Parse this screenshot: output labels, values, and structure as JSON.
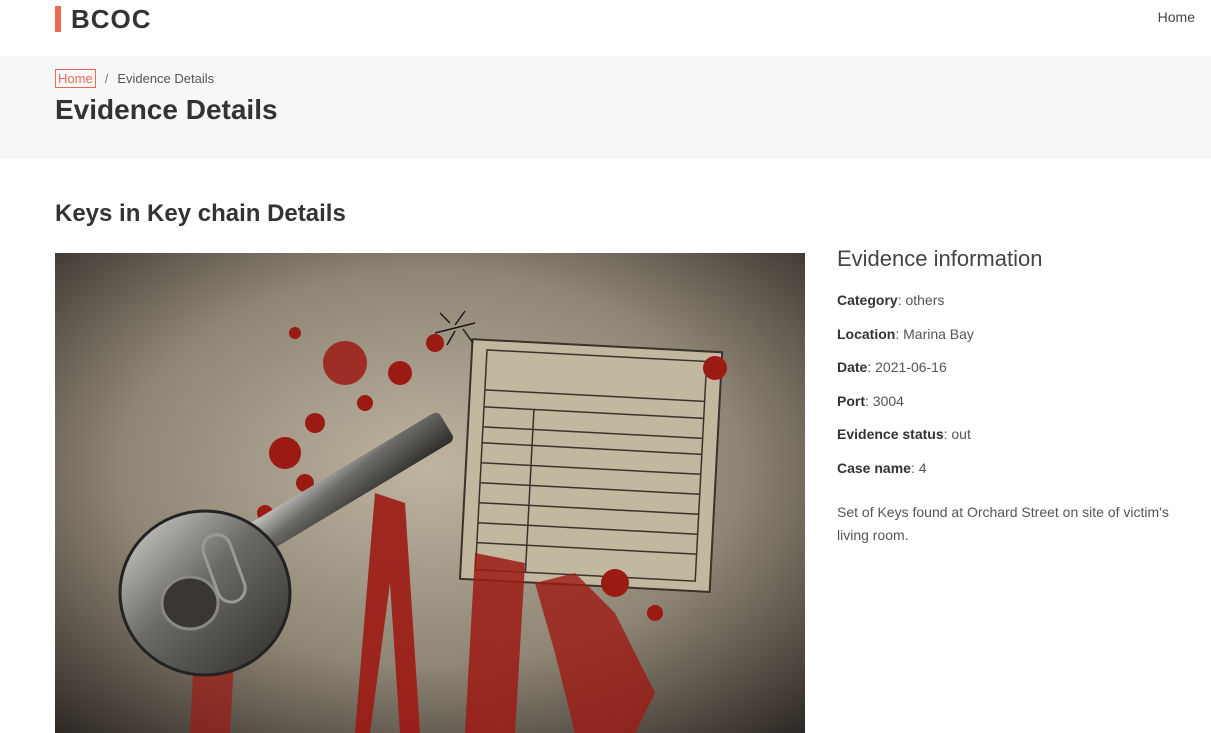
{
  "header": {
    "logo": "BCOC",
    "nav_home": "Home"
  },
  "breadcrumb": {
    "home": "Home",
    "separator": "/",
    "current": "Evidence Details"
  },
  "page_title": "Evidence Details",
  "details_title": "Keys in Key chain Details",
  "info": {
    "heading": "Evidence information",
    "rows": [
      {
        "label": "Category",
        "value": "others"
      },
      {
        "label": "Location",
        "value": "Marina Bay"
      },
      {
        "label": "Date",
        "value": "2021-06-16"
      },
      {
        "label": "Port",
        "value": "3004"
      },
      {
        "label": "Evidence status",
        "value": "out"
      },
      {
        "label": "Case name",
        "value": "4"
      }
    ],
    "description": "Set of Keys found at Orchard Street on site of victim's living room."
  },
  "colors": {
    "accent": "#e96b56",
    "section_bg": "#f7f7f7"
  }
}
